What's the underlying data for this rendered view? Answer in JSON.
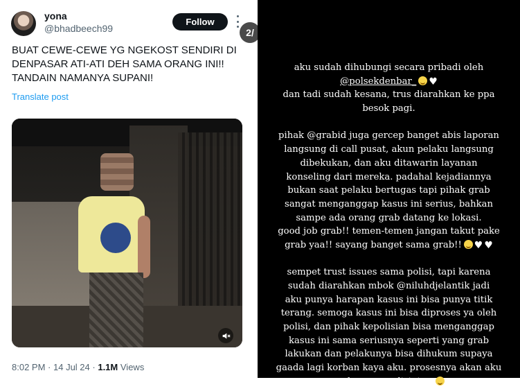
{
  "tweet": {
    "author_name": "yona",
    "author_handle": "@bhadbeech99",
    "follow_label": "Follow",
    "pager_label": "2/",
    "text": "BUAT CEWE-CEWE YG NGEKOST SENDIRI DI DENPASAR ATI-ATI DEH SAMA ORANG INI!! TANDAIN NAMANYA SUPANI!",
    "translate_label": "Translate post",
    "time": "8:02 PM",
    "date": "14 Jul 24",
    "views_count": "1.1M",
    "views_label": "Views",
    "colors": {
      "accent": "#1d9bf0",
      "text": "#0f1419",
      "muted": "#536471"
    }
  },
  "story": {
    "lines": [
      "aku sudah dihubungi secara pribadi oleh",
      "@polsekdenbar_",
      "dan tadi sudah kesana, trus diarahkan ke ppa",
      "besok pagi.",
      "",
      "pihak @grabid juga gercep banget abis laporan",
      "langsung di call pusat,  akun pelaku langsung",
      "dibekukan, dan aku ditawarin layanan",
      "konseling dari mereka. padahal kejadiannya",
      "bukan saat pelaku bertugas tapi pihak grab",
      "sangat menganggap kasus ini serius, bahkan",
      "sampe ada orang grab datang ke lokasi.",
      "good job grab!! temen-temen jangan takut pake",
      "grab yaa!! sayang banget sama grab!!",
      "",
      "sempet trust issues sama polisi, tapi karena",
      "sudah diarahkan mbok @niluhdjelantik jadi",
      "aku punya harapan kasus ini bisa punya titik",
      "terang. semoga kasus ini bisa diproses ya oleh",
      "polisi, dan pihak kepolisian bisa menganggap",
      "kasus ini sama seriusnya seperti yang grab",
      "lakukan dan pelakunya bisa dihukum supaya",
      "gaada lagi korban kaya aku. prosesnya akan aku",
      "update terus disini ya"
    ]
  }
}
